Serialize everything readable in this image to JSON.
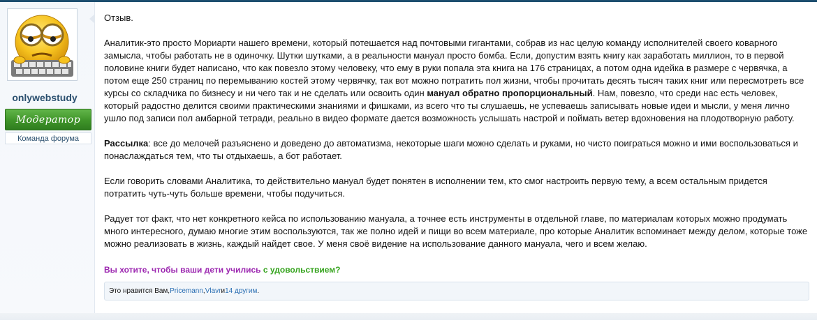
{
  "sidebar": {
    "username": "onlywebstudy",
    "badge": "Модератор",
    "team": "Команда форума"
  },
  "post": {
    "title": "Отзыв.",
    "p1": "Аналитик-это просто Мориарти нашего времени, который потешается над почтовыми гигантами, собрав из нас целую команду исполнителей своего коварного замысла, чтобы работать не в одиночку. Шутки шутками, а в реальности мануал просто бомба. Если, допустим взять книгу как заработать миллион, то в первой половине книги будет написано, что как повезло этому человеку, что ему в руки попала эта книга на 176 страницах, а потом одна идейка в размере с червячка, а потом еще 250 страниц по перемыванию костей этому червячку, так вот можно потратить пол жизни, чтобы прочитать десять тысяч таких книг или пересмотреть все курсы со складчика по бизнесу и ни чего так и не сделать или освоить один ",
    "p1_bold": "мануал обратно пропорциональный",
    "p1_tail": ". Нам, повезло, что среди нас есть человек, который радостно делится своими практическими знаниями и фишками, из всего что ты слушаешь, не успеваешь записывать новые идеи и мысли, у меня лично ушло под записи пол амбарной тетради, реально в видео формате дается возможность услышать настрой и поймать ветер вдохновения на плодотворную работу.",
    "p2_bold": "Рассылка",
    "p2": ": все до мелочей разъяснено и доведено до автоматизма, некоторые шаги можно сделать и руками, но чисто поиграться можно и ими воспользоваться и понаслаждаться тем, что ты отдыхаешь, а бот работает.",
    "p3": "Если говорить словами Аналитика, то действительно мануал будет понятен в исполнении тем, кто смог настроить первую тему, а всем остальным придется потратить чуть-чуть больше времени, чтобы подучиться.",
    "p4": "Радует тот факт, что нет конкретного кейса по использованию мануала, а точнее есть инструменты в отдельной главе, по материалам которых можно продумать много интересного, думаю многие этим воспользуются, так же полно идей и пищи во всем материале, про которые Аналитик вспоминает между делом, которые тоже можно реализовать в жизнь, каждый найдет свое. У меня своё видение на использование данного мануала, чего и всем желаю."
  },
  "promo": {
    "part1": "Вы хотите, чтобы ваши дети учились ",
    "part2": "с удовольствием?",
    "color1": "#9c27b0",
    "color2": "#35a31d"
  },
  "likes": {
    "prefix": "Это нравится Вам, ",
    "user1": "Pricemann",
    "sep": ", ",
    "user2": "Vlavr",
    "and": " и ",
    "others": "14 другим",
    "dot": "."
  }
}
